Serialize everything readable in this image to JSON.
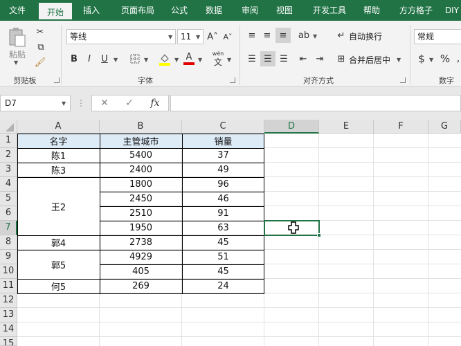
{
  "tabs": [
    "文件",
    "开始",
    "插入",
    "页面布局",
    "公式",
    "数据",
    "审阅",
    "视图",
    "开发工具",
    "帮助",
    "方方格子",
    "DIY"
  ],
  "active_tab_index": 1,
  "ribbon": {
    "clipboard": {
      "label": "剪贴板",
      "paste_label": "粘贴"
    },
    "font": {
      "label": "字体",
      "font_name": "等线",
      "font_size": "11",
      "bold": "B",
      "italic": "I",
      "underline": "U",
      "phonetic_top": "wén",
      "phonetic_bottom": "文"
    },
    "alignment": {
      "label": "对齐方式",
      "wrap_label": "自动换行",
      "merge_label": "合并后居中"
    },
    "number": {
      "label": "数字",
      "format": "常规",
      "currency": "$",
      "percent": "%"
    }
  },
  "namebox": {
    "value": "D7"
  },
  "formula_bar": {
    "fx": "fx",
    "value": ""
  },
  "columns": [
    "A",
    "B",
    "C",
    "D",
    "E",
    "F",
    "G"
  ],
  "selected_column": "D",
  "rows": [
    "1",
    "2",
    "3",
    "4",
    "5",
    "6",
    "7",
    "8",
    "9",
    "10",
    "11",
    "12",
    "13",
    "14",
    "15"
  ],
  "selected_row": "7",
  "table": {
    "headers": [
      "名字",
      "主管城市",
      "销量"
    ],
    "names": [
      "陈1",
      "陈3",
      "王2",
      "郭4",
      "郭5",
      "何5"
    ],
    "cities": [
      "5400",
      "2400",
      "1800",
      "2450",
      "2510",
      "1950",
      "2738",
      "4929",
      "405",
      "269"
    ],
    "sales": [
      "37",
      "49",
      "96",
      "46",
      "91",
      "63",
      "45",
      "51",
      "45",
      "24"
    ]
  },
  "colors": {
    "accent": "#217346",
    "header_fill": "#ddebf7"
  }
}
